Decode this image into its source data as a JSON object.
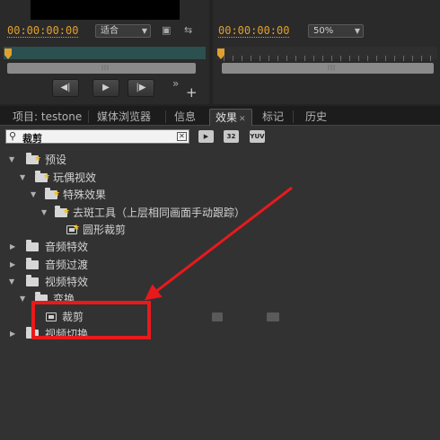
{
  "source_monitor": {
    "timecode": "00:00:00:00",
    "fit_select": "适合"
  },
  "program_monitor": {
    "timecode": "00:00:00:00",
    "zoom_select": "50%"
  },
  "tabs": [
    {
      "label": "项目: testone"
    },
    {
      "label": "媒体浏览器"
    },
    {
      "label": "信息"
    },
    {
      "label": "效果"
    },
    {
      "label": "标记"
    },
    {
      "label": "历史"
    }
  ],
  "search": {
    "value": "裁剪"
  },
  "toolbar": {
    "btn_32": "32",
    "btn_yuv": "YUV"
  },
  "tree": {
    "presets": "预设",
    "toy_effects": "玩偶视效",
    "special_effects": "特殊效果",
    "spot_remove": "去斑工具（上层相同画面手动跟踪）",
    "circle_crop": "圆形裁剪",
    "audio_effects": "音频特效",
    "audio_transitions": "音频过渡",
    "video_effects": "视频特效",
    "transform": "变换",
    "crop": "裁剪",
    "video_transitions": "视频切换"
  },
  "annotation": {
    "color": "#e8191c"
  }
}
